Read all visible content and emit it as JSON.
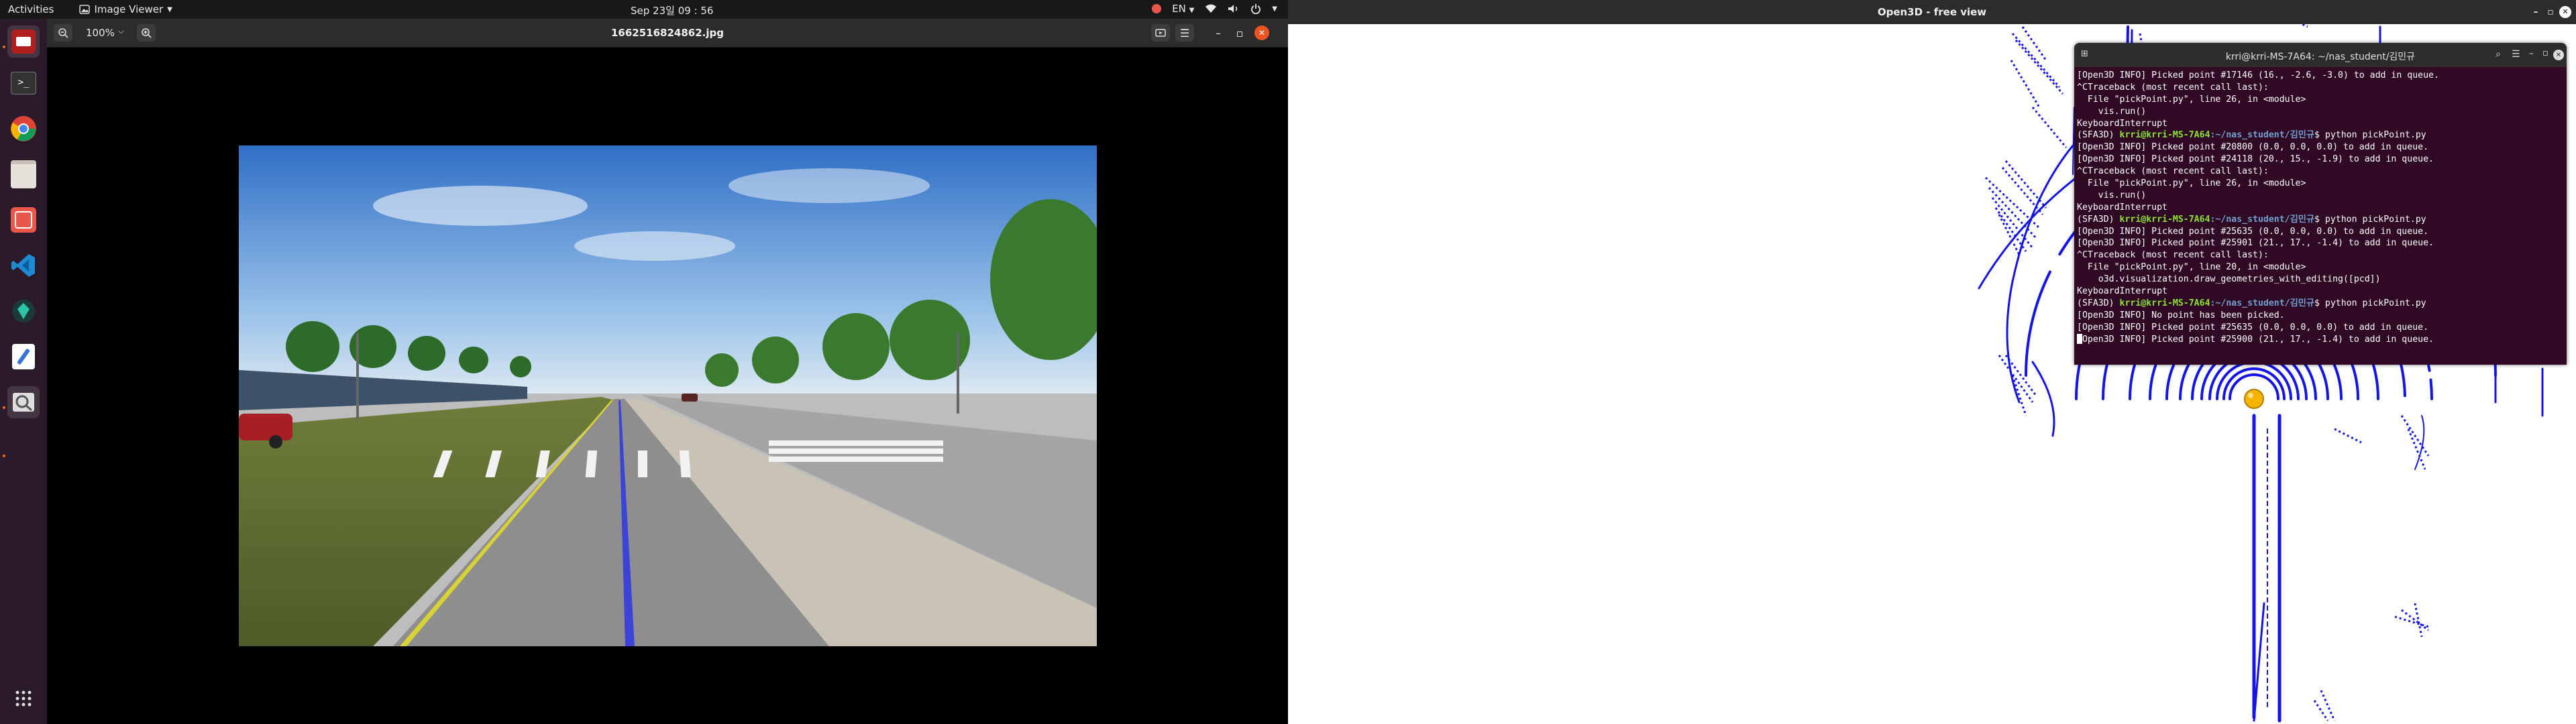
{
  "topbar": {
    "activities": "Activities",
    "app_menu": "Image Viewer",
    "clock": "Sep 23일  09 : 56",
    "lang": "EN",
    "icons": [
      "record-icon",
      "network-icon",
      "volume-icon",
      "power-icon",
      "chevron-down-icon"
    ]
  },
  "dock": {
    "apps": [
      "terminal-icon",
      "chrome-icon",
      "files-icon",
      "software-icon",
      "vscode-icon",
      "app-icon",
      "text-editor-icon",
      "image-viewer-icon"
    ],
    "grid": "show-apps-icon"
  },
  "viewer": {
    "zoom": "100%",
    "file_name": "1662516824862.jpg"
  },
  "o3d": {
    "title": "Open3D - free view"
  },
  "terminal": {
    "title": "krri@krri-MS-7A64: ~/nas_student/김민규",
    "lines": [
      {
        "t": "plain",
        "text": "[Open3D INFO] Picked point #17146 (16., -2.6, -3.0) to add in queue."
      },
      {
        "t": "plain",
        "text": "^CTraceback (most recent call last):"
      },
      {
        "t": "plain",
        "text": "  File \"pickPoint.py\", line 26, in <module>"
      },
      {
        "t": "plain",
        "text": "    vis.run()"
      },
      {
        "t": "plain",
        "text": "KeyboardInterrupt"
      },
      {
        "t": "prompt",
        "env": "(SFA3D) ",
        "user": "krri@krri-MS-7A64",
        "path": ":~/nas_student/김민규",
        "cmd": "$ python pickPoint.py"
      },
      {
        "t": "plain",
        "text": "[Open3D INFO] Picked point #20800 (0.0, 0.0, 0.0) to add in queue."
      },
      {
        "t": "plain",
        "text": "[Open3D INFO] Picked point #24118 (20., 15., -1.9) to add in queue."
      },
      {
        "t": "plain",
        "text": "^CTraceback (most recent call last):"
      },
      {
        "t": "plain",
        "text": "  File \"pickPoint.py\", line 26, in <module>"
      },
      {
        "t": "plain",
        "text": "    vis.run()"
      },
      {
        "t": "plain",
        "text": "KeyboardInterrupt"
      },
      {
        "t": "prompt",
        "env": "(SFA3D) ",
        "user": "krri@krri-MS-7A64",
        "path": ":~/nas_student/김민규",
        "cmd": "$ python pickPoint.py"
      },
      {
        "t": "plain",
        "text": "[Open3D INFO] Picked point #25635 (0.0, 0.0, 0.0) to add in queue."
      },
      {
        "t": "plain",
        "text": "[Open3D INFO] Picked point #25901 (21., 17., -1.4) to add in queue."
      },
      {
        "t": "plain",
        "text": "^CTraceback (most recent call last):"
      },
      {
        "t": "plain",
        "text": "  File \"pickPoint.py\", line 20, in <module>"
      },
      {
        "t": "plain",
        "text": "    o3d.visualization.draw_geometries_with_editing([pcd])"
      },
      {
        "t": "plain",
        "text": "KeyboardInterrupt"
      },
      {
        "t": "prompt",
        "env": "(SFA3D) ",
        "user": "krri@krri-MS-7A64",
        "path": ":~/nas_student/김민규",
        "cmd": "$ python pickPoint.py"
      },
      {
        "t": "plain",
        "text": "[Open3D INFO] No point has been picked."
      },
      {
        "t": "plain",
        "text": "[Open3D INFO] Picked point #25635 (0.0, 0.0, 0.0) to add in queue."
      },
      {
        "t": "plain",
        "text": "[Open3D INFO] Picked point #25900 (21., 17., -1.4) to add in queue."
      },
      {
        "t": "plain",
        "text": ""
      }
    ]
  }
}
